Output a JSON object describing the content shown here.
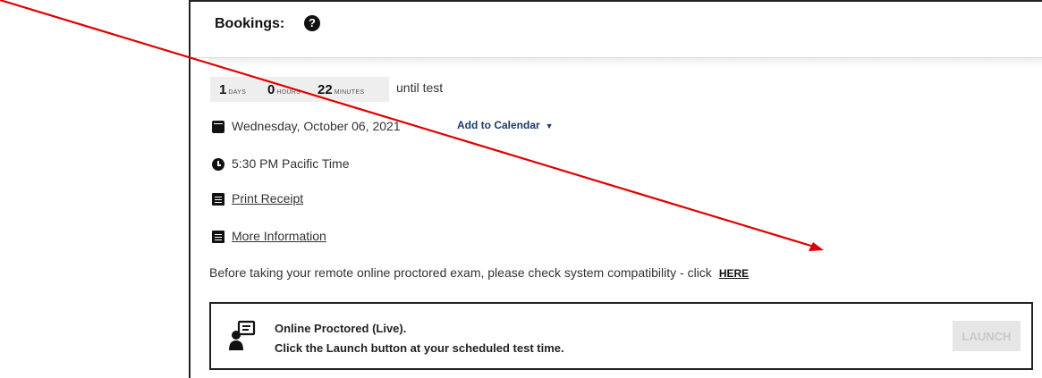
{
  "bookings": {
    "title": "Bookings:",
    "help_icon_glyph": "?"
  },
  "countdown": {
    "days_value": "1",
    "days_label": "DAYS",
    "hours_value": "0",
    "hours_label": "HOURS",
    "minutes_value": "22",
    "minutes_label": "MINUTES",
    "suffix": "until test"
  },
  "schedule": {
    "date": "Wednesday, October 06, 2021",
    "add_to_calendar": "Add to Calendar",
    "time": "5:30 PM  Pacific Time"
  },
  "links": {
    "print_receipt": "Print Receipt",
    "more_information": "More Information"
  },
  "compatibility": {
    "text": "Before taking your remote online proctored exam, please check system compatibility - click",
    "link": "HERE"
  },
  "proctor": {
    "title": "Online Proctored (Live).",
    "subtitle": "Click the Launch button at your scheduled test time.",
    "launch_label": "LAUNCH"
  },
  "icons": {
    "help": "question-circle-icon",
    "calendar": "calendar-icon",
    "clock": "clock-icon",
    "receipt": "document-icon",
    "info": "document-icon",
    "caret": "caret-down-icon",
    "proctor": "person-screen-icon"
  },
  "colors": {
    "annotation_arrow": "#e00000",
    "link_blue": "#1a3a6b",
    "disabled_button": "#e6e6e6"
  }
}
